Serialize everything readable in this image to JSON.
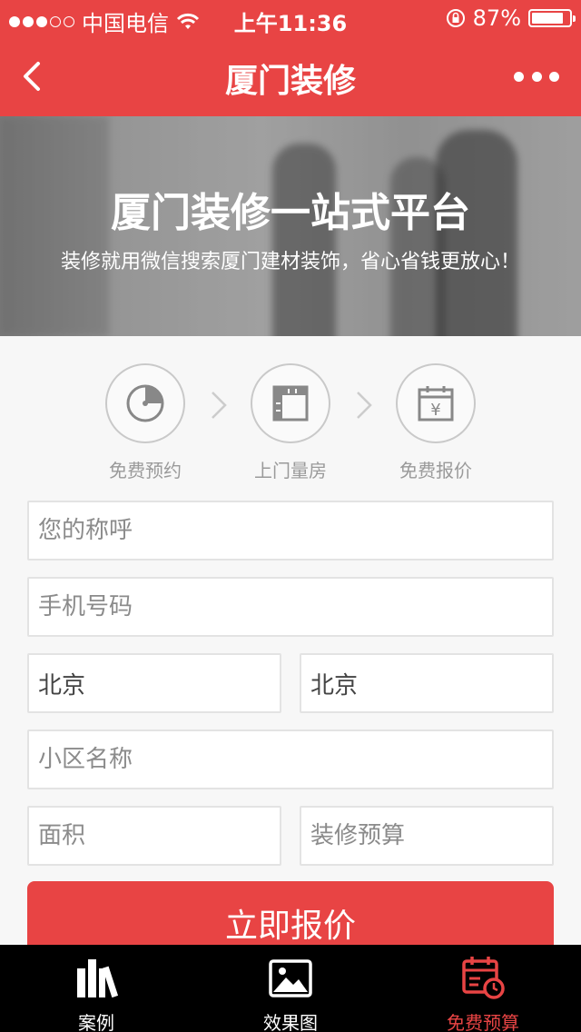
{
  "status_bar": {
    "carrier": "中国电信",
    "time": "上午11:36",
    "battery_percent": "87%",
    "battery_level": 0.87,
    "signal_bars_filled": 3,
    "signal_bars_total": 5
  },
  "nav": {
    "title": "厦门装修",
    "back_icon": "chevron-left-icon",
    "more_icon": "more-dots-icon"
  },
  "hero": {
    "title": "厦门装修一站式平台",
    "subtitle": "装修就用微信搜索厦门建材装饰，省心省钱更放心！"
  },
  "steps": [
    {
      "label": "免费预约",
      "icon": "clock-icon"
    },
    {
      "label": "上门量房",
      "icon": "ruler-icon"
    },
    {
      "label": "免费报价",
      "icon": "calendar-yen-icon"
    }
  ],
  "form": {
    "name_placeholder": "您的称呼",
    "phone_placeholder": "手机号码",
    "province_value": "北京",
    "city_value": "北京",
    "community_placeholder": "小区名称",
    "area_placeholder": "面积",
    "budget_placeholder": "装修预算",
    "submit_label": "立即报价"
  },
  "tabs": [
    {
      "label": "案例",
      "icon": "books-icon",
      "active": false
    },
    {
      "label": "效果图",
      "icon": "image-icon",
      "active": false
    },
    {
      "label": "免费预算",
      "icon": "calendar-clock-icon",
      "active": true
    }
  ],
  "colors": {
    "brand_red": "#e84444",
    "tab_bar_bg": "#000000",
    "page_bg": "#f7f7f7"
  }
}
